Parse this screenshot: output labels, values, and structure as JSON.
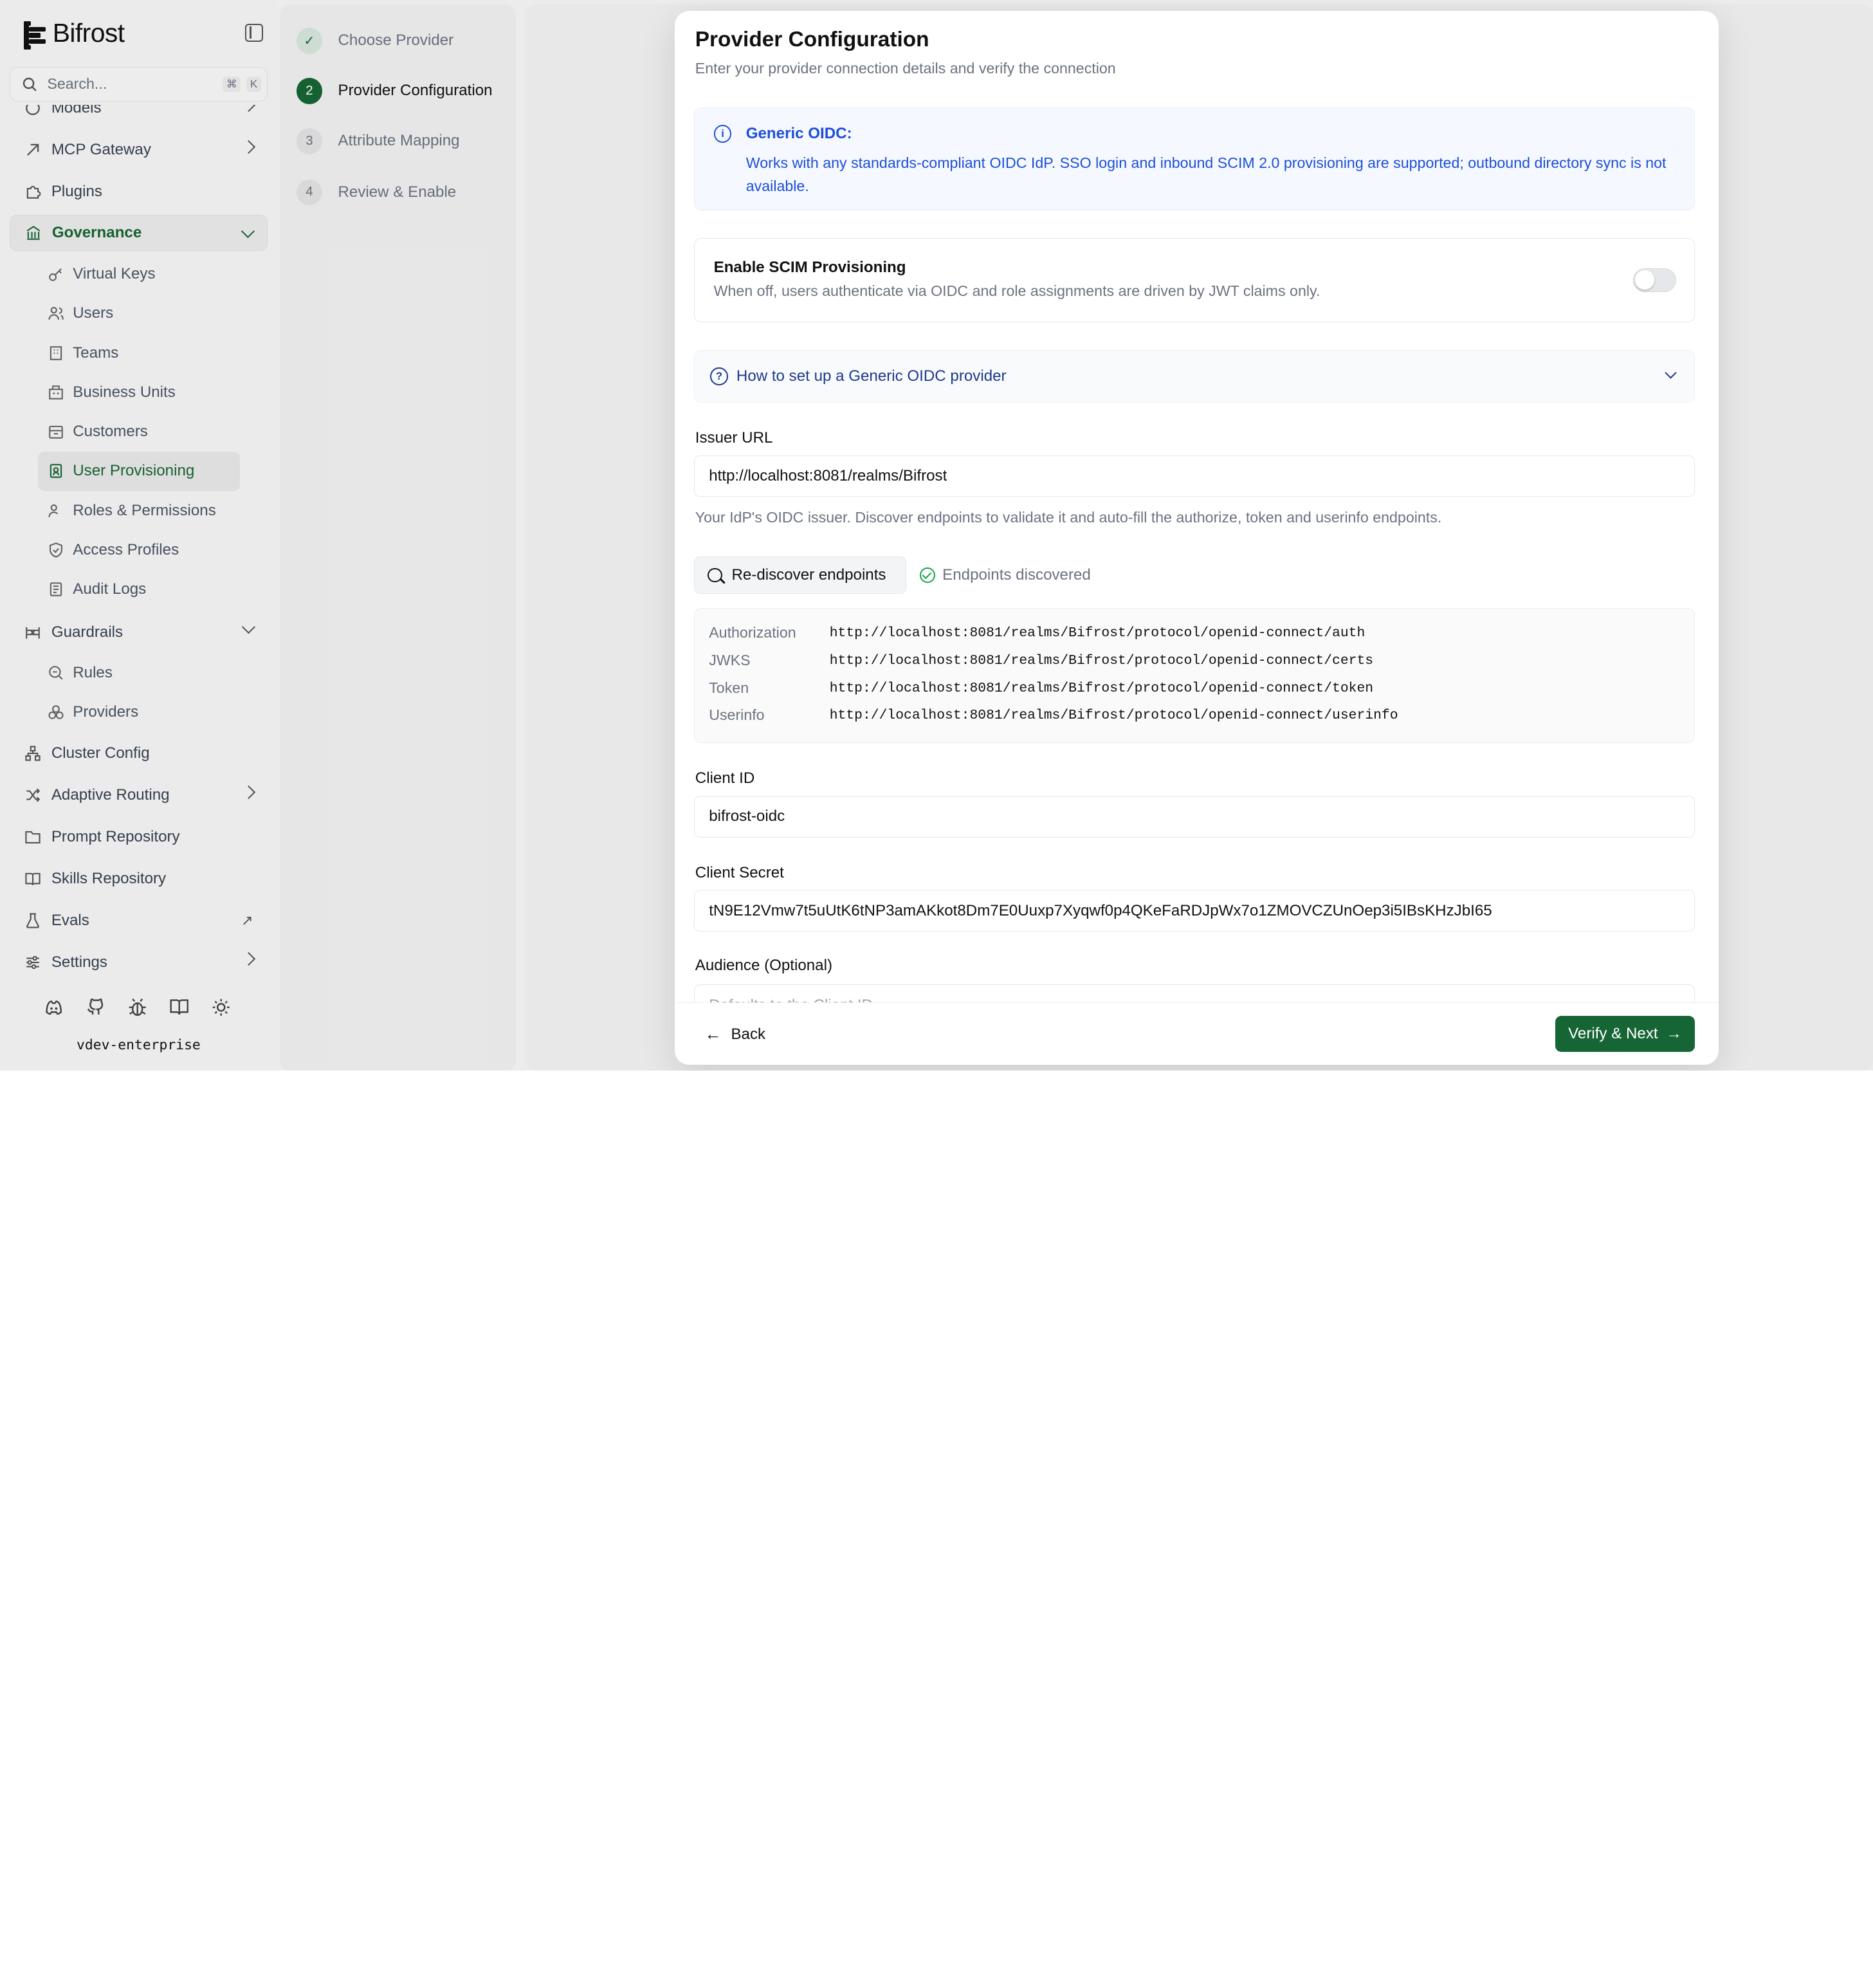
{
  "app": {
    "name": "Bifrost",
    "version": "vdev-enterprise"
  },
  "search": {
    "placeholder": "Search...",
    "shortcut_mod": "⌘",
    "shortcut_key": "K"
  },
  "nav": {
    "models": "Models",
    "mcp_gateway": "MCP Gateway",
    "plugins": "Plugins",
    "governance": "Governance",
    "governance_items": [
      "Virtual Keys",
      "Users",
      "Teams",
      "Business Units",
      "Customers",
      "User Provisioning",
      "Roles & Permissions",
      "Access Profiles",
      "Audit Logs"
    ],
    "guardrails": "Guardrails",
    "guardrails_items": [
      "Rules",
      "Providers"
    ],
    "cluster_config": "Cluster Config",
    "adaptive_routing": "Adaptive Routing",
    "prompt_repository": "Prompt Repository",
    "skills_repository": "Skills Repository",
    "evals": "Evals",
    "settings": "Settings"
  },
  "steps": [
    {
      "num": "✓",
      "label": "Choose Provider"
    },
    {
      "num": "2",
      "label": "Provider Configuration"
    },
    {
      "num": "3",
      "label": "Attribute Mapping"
    },
    {
      "num": "4",
      "label": "Review & Enable"
    }
  ],
  "modal": {
    "title": "Provider Configuration",
    "subtitle": "Enter your provider connection details and verify the connection",
    "info_title": "Generic OIDC:",
    "info_body": "Works with any standards-compliant OIDC IdP. SSO login and inbound SCIM 2.0 provisioning are supported; outbound directory sync is not available.",
    "scim_title": "Enable SCIM Provisioning",
    "scim_desc": "When off, users authenticate via OIDC and role assignments are driven by JWT claims only.",
    "howto": "How to set up a Generic OIDC provider",
    "issuer_label": "Issuer URL",
    "issuer_value": "http://localhost:8081/realms/Bifrost",
    "issuer_help": "Your IdP's OIDC issuer. Discover endpoints to validate it and auto-fill the authorize, token and userinfo endpoints.",
    "rediscover": "Re-discover endpoints",
    "discovered": "Endpoints discovered",
    "endpoints": [
      {
        "key": "Authorization",
        "value": "http://localhost:8081/realms/Bifrost/protocol/openid-connect/auth"
      },
      {
        "key": "JWKS",
        "value": "http://localhost:8081/realms/Bifrost/protocol/openid-connect/certs"
      },
      {
        "key": "Token",
        "value": "http://localhost:8081/realms/Bifrost/protocol/openid-connect/token"
      },
      {
        "key": "Userinfo",
        "value": "http://localhost:8081/realms/Bifrost/protocol/openid-connect/userinfo"
      }
    ],
    "client_id_label": "Client ID",
    "client_id_value": "bifrost-oidc",
    "client_secret_label": "Client Secret",
    "client_secret_value": "tN9E12Vmw7t5uUtK6tNP3amAKkot8Dm7E0Uuxp7Xyqwf0p4QKeFaRDJpWx7o1ZMOVCZUnOep3i5IBsKHzJbI65",
    "audience_label": "Audience (Optional)",
    "audience_placeholder": "Defaults to the Client ID",
    "back": "Back",
    "next": "Verify & Next"
  },
  "colors": {
    "accent": "#166534",
    "info": "#1d4ed8"
  }
}
